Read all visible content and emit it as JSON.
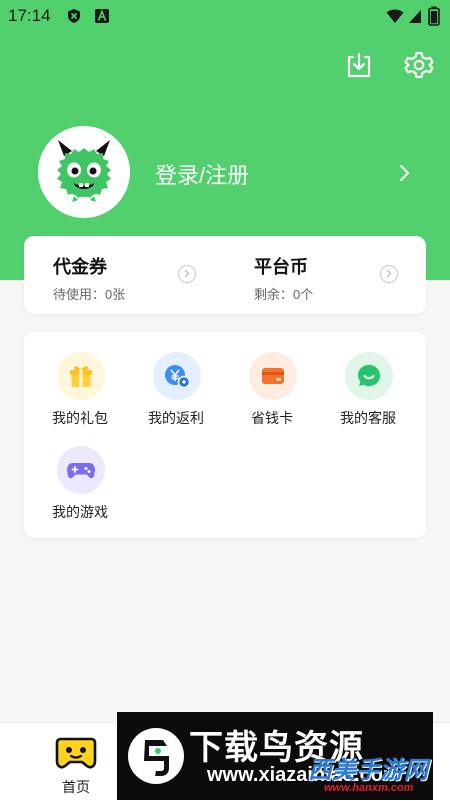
{
  "status_bar": {
    "time": "17:14",
    "icons": [
      "shield-x-icon",
      "a-badge-icon",
      "wifi-icon",
      "cellular-icon",
      "battery-icon"
    ]
  },
  "header": {
    "icons": [
      "download-icon",
      "settings-icon"
    ]
  },
  "profile": {
    "login_label": "登录/注册"
  },
  "wallet": {
    "voucher": {
      "title": "代金券",
      "subtitle": "待使用：0张"
    },
    "coin": {
      "title": "平台币",
      "subtitle": "剩余：0个"
    }
  },
  "services": [
    {
      "label": "我的礼包",
      "icon": "gift-icon",
      "color": "#ffc21f",
      "bg": "#fff6dc"
    },
    {
      "label": "我的返利",
      "icon": "rebate-yen-icon",
      "color": "#3b8ef3",
      "bg": "#e3efff"
    },
    {
      "label": "省钱卡",
      "icon": "card-icon",
      "color": "#f5732a",
      "bg": "#ffece0"
    },
    {
      "label": "我的客服",
      "icon": "chat-icon",
      "color": "#27c46c",
      "bg": "#dff6e8"
    },
    {
      "label": "我的游戏",
      "icon": "gamepad-icon",
      "color": "#7b6cf0",
      "bg": "#ece9ff"
    }
  ],
  "tabbar": {
    "home_label": "首页"
  },
  "watermark": {
    "title": "下载鸟资源",
    "url": "www.xiazainiao.com",
    "site2_title": "西美手游网",
    "site2_url": "www.hanxm.com"
  },
  "colors": {
    "brand_green": "#52d06e"
  }
}
